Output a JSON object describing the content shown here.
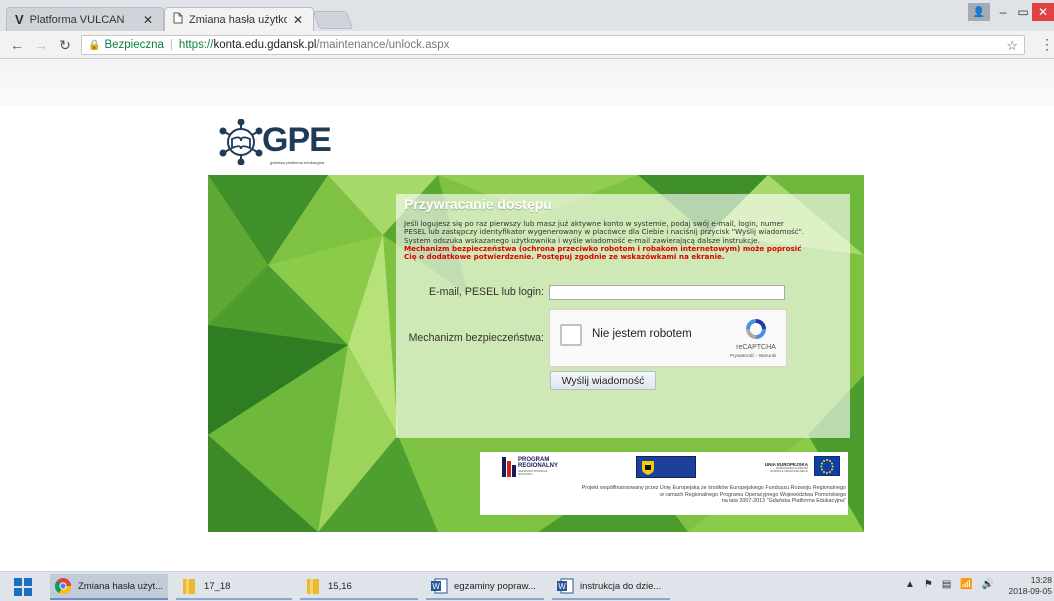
{
  "browser": {
    "tabs": [
      {
        "title": "Platforma VULCAN",
        "favicon": "V",
        "active": false
      },
      {
        "title": "Zmiana hasła użytkownik",
        "favicon": "page-icon",
        "active": true
      }
    ],
    "window_controls": {
      "user": "👤",
      "min": "–",
      "max": "▭",
      "close": "✕"
    },
    "address": {
      "secure_label": "Bezpieczna",
      "scheme": "https://",
      "host": "konta.edu.gdansk.pl",
      "path": "/maintenance/unlock.aspx"
    }
  },
  "logo": {
    "text": "GPE",
    "subtitle": "gdańska platforma edukacyjna"
  },
  "form": {
    "title": "Przywracanie dostępu",
    "info_lines": [
      "Jeśli logujesz się po raz pierwszy lub masz już aktywne konto w systemie, podaj swój e-mail, login, numer",
      "PESEL lub zastępczy identyfikator wygenerowany w placówce dla Ciebie i naciśnij przycisk \"Wyślij wiadomość\".",
      "System odszuka wskazanego użytkownika i wyśle wiadomość e-mail zawierającą dalsze instrukcje."
    ],
    "warning_lines": [
      "Mechanizm bezpieczeństwa (ochrona przeciwko robotom i robakom internetowym) może poprosić",
      "Cię o dodatkowe potwierdzenie. Postępuj zgodnie ze wskazówkami na ekranie."
    ],
    "email_label": "E-mail, PESEL lub login:",
    "email_value": "",
    "captcha_label": "Mechanizm bezpieczeństwa:",
    "captcha": {
      "checkbox_label": "Nie jestem robotem",
      "brand": "reCAPTCHA",
      "terms": "Prywatność - Warunki"
    },
    "submit_label": "Wyślij wiadomość"
  },
  "funding": {
    "logo_program": {
      "line1": "PROGRAM",
      "line2": "REGIONALNY",
      "line3": "NARODOWA STRATEGIA SPÓJNOŚCI"
    },
    "logo_eu": {
      "line1": "UNIA EUROPEJSKA",
      "line2": "EUROPEJSKI FUNDUSZ",
      "line3": "ROZWOJU REGIONALNEGO"
    },
    "text_lines": [
      "Projekt współfinansowany przez Unię Europejską ze środków Europejskiego Funduszu Rozwoju Regionalnego",
      "w ramach Regionalnego Programu Operacyjnego Województwa Pomorskiego",
      "na lata 2007-2013 \"Gdańska Platforma Edukacyjna\""
    ]
  },
  "taskbar": {
    "items": [
      {
        "label": "Zmiana hasła użyt...",
        "icon": "chrome-icon",
        "state": "active"
      },
      {
        "label": "17_18",
        "icon": "folder-icon",
        "state": "open"
      },
      {
        "label": "15,16",
        "icon": "folder-icon",
        "state": "open"
      },
      {
        "label": "egzaminy popraw...",
        "icon": "word-icon",
        "state": "open"
      },
      {
        "label": "instrukcja do dzie...",
        "icon": "word-icon",
        "state": "open"
      }
    ],
    "tray": [
      "▲",
      "⚑",
      "▤",
      "📶",
      "🔊"
    ],
    "time": "13:28",
    "date": "2018-09-05"
  }
}
